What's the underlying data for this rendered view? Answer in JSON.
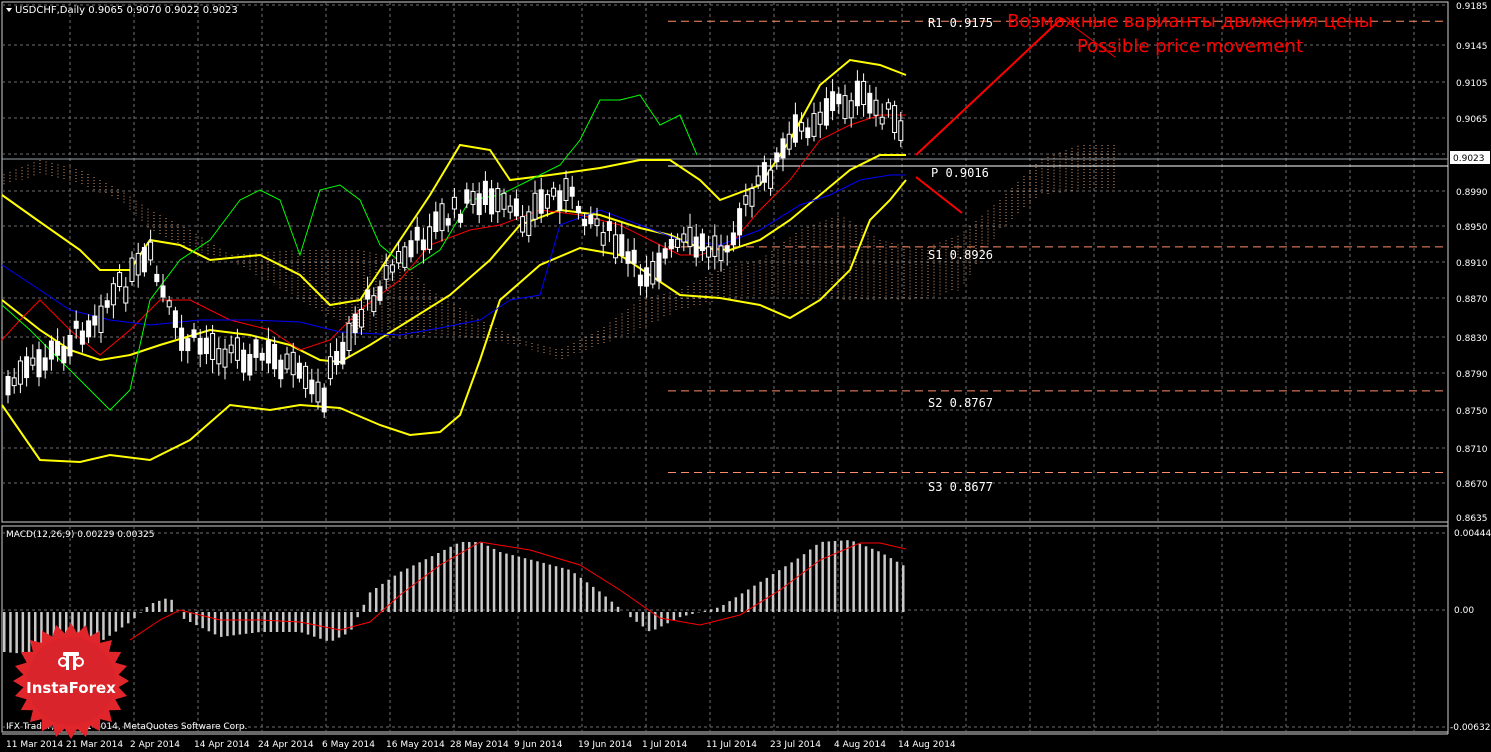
{
  "window": {
    "symbol_line": "USDCHF,Daily  0.9065 0.9070 0.9022 0.9023",
    "current_price": "0.9023",
    "copyright": "IFX Trader, © 2001-2014, MetaQuotes Software Corp.",
    "brand": "InstaForex"
  },
  "annotation": {
    "line1": "Возможные варианты движения цены",
    "line2": "Possible price movement"
  },
  "pivots": [
    {
      "label": "R1",
      "value": 0.9175,
      "text": "R1  0.9175"
    },
    {
      "label": "P",
      "value": 0.9016,
      "text": "P  0.9016"
    },
    {
      "label": "S1",
      "value": 0.8926,
      "text": "S1  0.8926"
    },
    {
      "label": "S2",
      "value": 0.8767,
      "text": "S2  0.8767"
    },
    {
      "label": "S3",
      "value": 0.8677,
      "text": "S3  0.8677"
    }
  ],
  "price_axis": [
    "0.9185",
    "0.9145",
    "0.9105",
    "0.9065",
    "0.8990",
    "0.8950",
    "0.8910",
    "0.8870",
    "0.8830",
    "0.8790",
    "0.8750",
    "0.8710",
    "0.8670",
    "0.8635"
  ],
  "macd": {
    "label": "MACD(12,26,9) 0.00229 0.00325",
    "axis": [
      "0.00444",
      "0.00",
      "-0.00632"
    ]
  },
  "date_axis": [
    "11 Mar 2014",
    "21 Mar 2014",
    "2 Apr 2014",
    "14 Apr 2014",
    "24 Apr 2014",
    "6 May 2014",
    "16 May 2014",
    "28 May 2014",
    "9 Jun 2014",
    "19 Jun 2014",
    "1 Jul 2014",
    "11 Jul 2014",
    "23 Jul 2014",
    "4 Aug 2014",
    "14 Aug 2014"
  ],
  "colors": {
    "background": "#000000",
    "grid": "#6e6e6e",
    "bull_candle": "#ffffff",
    "bear_candle": "#ffffff",
    "bollinger": "#ffff00",
    "tenkan": "#ff0000",
    "kijun": "#0000ff",
    "chikou": "#00ff00",
    "kumo": "#ffb478",
    "pivot_line": "#ff8c69",
    "annotation": "#ff0000",
    "macd_hist": "#c8c8c8",
    "macd_signal": "#ff0000"
  }
}
